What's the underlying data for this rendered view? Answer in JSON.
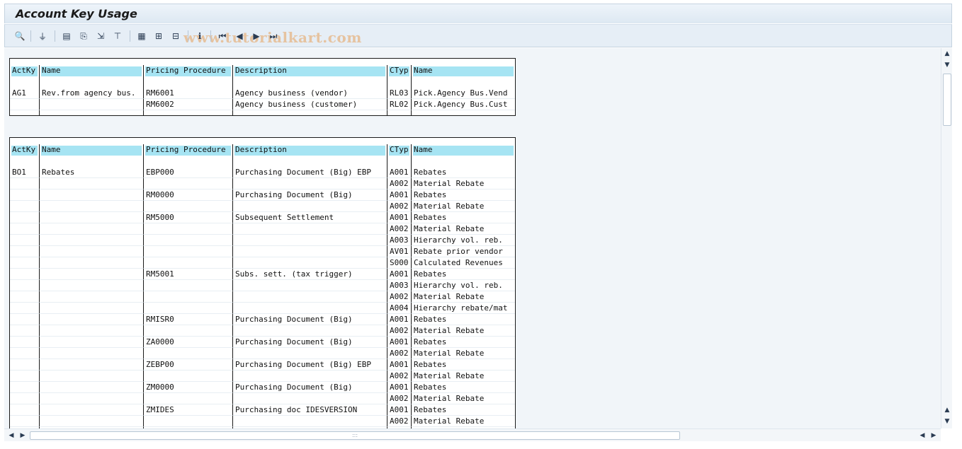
{
  "window": {
    "title": "Account Key Usage"
  },
  "watermark": "www.tutorialkart.com",
  "toolbar": {
    "buttons": [
      {
        "name": "magnifier-icon",
        "glyph": "🔍"
      },
      {
        "name": "filter-icon",
        "glyph": "⏚"
      },
      {
        "name": "excel-export-icon",
        "glyph": "▤"
      },
      {
        "name": "print-preview-icon",
        "glyph": "⎘"
      },
      {
        "name": "export-icon",
        "glyph": "⇲"
      },
      {
        "name": "word-processing-icon",
        "glyph": "⊤"
      },
      {
        "name": "layout-grid-icon",
        "glyph": "▦"
      },
      {
        "name": "select-layout-icon",
        "glyph": "⊞"
      },
      {
        "name": "save-layout-icon",
        "glyph": "⊟"
      },
      {
        "name": "info-icon",
        "glyph": "ℹ"
      },
      {
        "name": "first-page-icon",
        "glyph": "⏮"
      },
      {
        "name": "previous-page-icon",
        "glyph": "◀"
      },
      {
        "name": "next-page-icon",
        "glyph": "▶"
      },
      {
        "name": "last-page-icon",
        "glyph": "⏭"
      }
    ]
  },
  "columns": [
    "ActKy",
    "Name",
    "Pricing Procedure",
    "Description",
    "CTyp",
    "Name"
  ],
  "tables": [
    {
      "rows": [
        [
          "AG1",
          "Rev.from agency bus.",
          "RM6001",
          "Agency business (vendor)",
          "RL03",
          "Pick.Agency Bus.Vend"
        ],
        [
          "",
          "",
          "RM6002",
          "Agency business (customer)",
          "RL02",
          "Pick.Agency Bus.Cust"
        ]
      ]
    },
    {
      "rows": [
        [
          "BO1",
          "Rebates",
          "EBP000",
          "Purchasing Document (Big) EBP",
          "A001",
          "Rebates"
        ],
        [
          "",
          "",
          "",
          "",
          "A002",
          "Material Rebate"
        ],
        [
          "",
          "",
          "RM0000",
          "Purchasing Document (Big)",
          "A001",
          "Rebates"
        ],
        [
          "",
          "",
          "",
          "",
          "A002",
          "Material Rebate"
        ],
        [
          "",
          "",
          "RM5000",
          "Subsequent Settlement",
          "A001",
          "Rebates"
        ],
        [
          "",
          "",
          "",
          "",
          "A002",
          "Material Rebate"
        ],
        [
          "",
          "",
          "",
          "",
          "A003",
          "Hierarchy vol. reb."
        ],
        [
          "",
          "",
          "",
          "",
          "AV01",
          "Rebate prior vendor"
        ],
        [
          "",
          "",
          "",
          "",
          "S000",
          "Calculated Revenues"
        ],
        [
          "",
          "",
          "RM5001",
          "Subs. sett. (tax trigger)",
          "A001",
          "Rebates"
        ],
        [
          "",
          "",
          "",
          "",
          "A003",
          "Hierarchy vol. reb."
        ],
        [
          "",
          "",
          "",
          "",
          "A002",
          "Material Rebate"
        ],
        [
          "",
          "",
          "",
          "",
          "A004",
          "Hierarchy rebate/mat"
        ],
        [
          "",
          "",
          "RMISR0",
          "Purchasing Document (Big)",
          "A001",
          "Rebates"
        ],
        [
          "",
          "",
          "",
          "",
          "A002",
          "Material Rebate"
        ],
        [
          "",
          "",
          "ZA0000",
          "Purchasing Document (Big)",
          "A001",
          "Rebates"
        ],
        [
          "",
          "",
          "",
          "",
          "A002",
          "Material Rebate"
        ],
        [
          "",
          "",
          "ZEBP00",
          "Purchasing Document (Big) EBP",
          "A001",
          "Rebates"
        ],
        [
          "",
          "",
          "",
          "",
          "A002",
          "Material Rebate"
        ],
        [
          "",
          "",
          "ZM0000",
          "Purchasing Document (Big)",
          "A001",
          "Rebates"
        ],
        [
          "",
          "",
          "",
          "",
          "A002",
          "Material Rebate"
        ],
        [
          "",
          "",
          "ZMIDES",
          "Purchasing doc IDESVERSION",
          "A001",
          "Rebates"
        ],
        [
          "",
          "",
          "",
          "",
          "A002",
          "Material Rebate"
        ]
      ]
    }
  ],
  "scrollbars": {
    "up": "▲",
    "down": "▼",
    "left": "◀",
    "right": "▶",
    "grip": ":::"
  }
}
